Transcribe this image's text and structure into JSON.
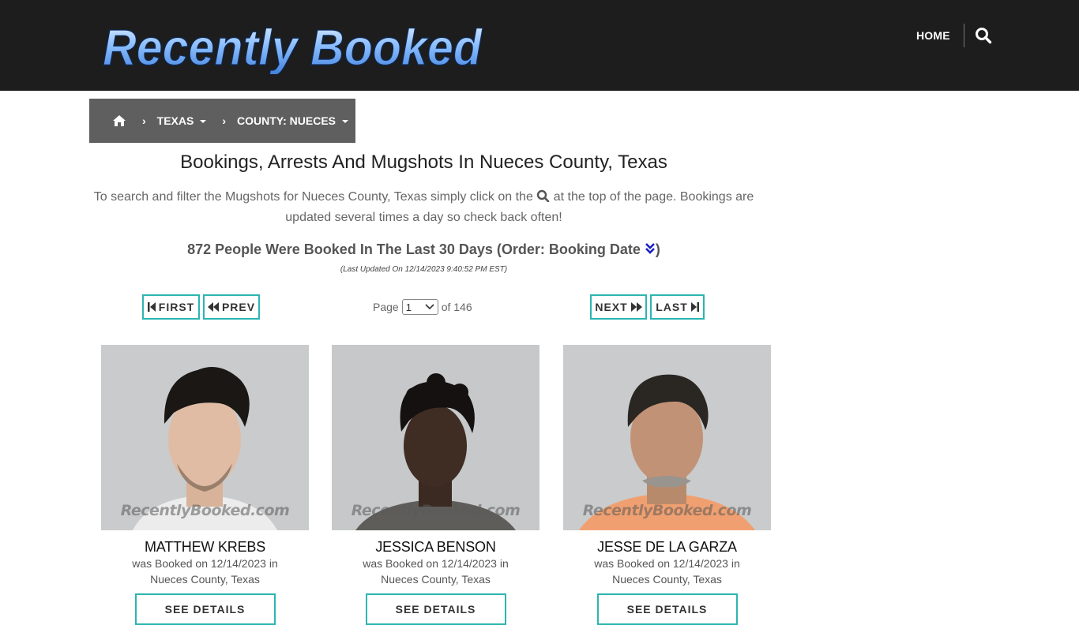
{
  "header": {
    "logo_text": "Recently Booked",
    "nav_home": "HOME",
    "search_icon": "search-icon"
  },
  "breadcrumb": {
    "home_icon": "home-icon",
    "items": [
      {
        "label": "TEXAS"
      },
      {
        "label": "COUNTY: NUECES"
      }
    ]
  },
  "main": {
    "title": "Bookings, Arrests And Mugshots In Nueces County, Texas",
    "intro_part1": "To search and filter the Mugshots for Nueces County, Texas simply click on the",
    "intro_part2": "at the top of the page. Bookings are updated several times a day so check back often!",
    "count_text": "872 People Were Booked In The Last 30 Days (Order: Booking Date",
    "count_close": ")",
    "updated": "(Last Updated On 12/14/2023 9:40:52 PM EST)"
  },
  "pagination": {
    "first": "FIRST",
    "prev": "PREV",
    "next": "NEXT",
    "last": "LAST",
    "page_label": "Page",
    "page_value": "1",
    "of_label": "of 146"
  },
  "bookings": [
    {
      "name": "MATTHEW KREBS",
      "booked_line": "was Booked on 12/14/2023 in",
      "location": "Nueces County, Texas",
      "button": "SEE DETAILS",
      "watermark": "RecentlyBooked.com"
    },
    {
      "name": "JESSICA BENSON",
      "booked_line": "was Booked on 12/14/2023 in",
      "location": "Nueces County, Texas",
      "button": "SEE DETAILS",
      "watermark": "RecentlyBooked.com"
    },
    {
      "name": "JESSE DE LA GARZA",
      "booked_line": "was Booked on 12/14/2023 in",
      "location": "Nueces County, Texas",
      "button": "SEE DETAILS",
      "watermark": "RecentlyBooked.com"
    }
  ],
  "colors": {
    "header_bg": "#1d1d1d",
    "breadcrumb_bg": "#5f5f5f",
    "accent_teal": "#2cb5b1",
    "logo_blue": "#6fa8f0"
  }
}
